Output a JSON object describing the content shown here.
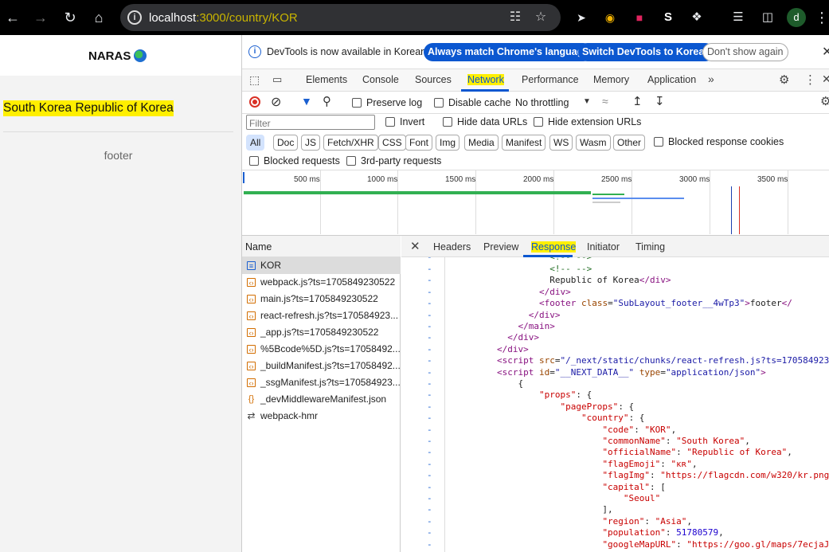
{
  "browser": {
    "url_host": "localhost",
    "url_rest": ":3000/country/KOR",
    "profile_initial": "d"
  },
  "page": {
    "logo": "NARAS",
    "country_title": "South Korea Republic of Korea",
    "footer": "footer"
  },
  "devtools": {
    "infobar": {
      "text": "DevTools is now available in Korean!",
      "btn_match": "Always match Chrome's language",
      "btn_switch": "Switch DevTools to Korean",
      "btn_dont": "Don't show again"
    },
    "tabs": [
      "Elements",
      "Console",
      "Sources",
      "Network",
      "Performance",
      "Memory",
      "Application"
    ],
    "selected_tab": "Network",
    "toolbar": {
      "preserve_log": "Preserve log",
      "disable_cache": "Disable cache",
      "throttling": "No throttling"
    },
    "filter": {
      "placeholder": "Filter",
      "invert": "Invert",
      "hide_data_urls": "Hide data URLs",
      "hide_extension_urls": "Hide extension URLs"
    },
    "type_filters": [
      "All",
      "Doc",
      "JS",
      "Fetch/XHR",
      "CSS",
      "Font",
      "Img",
      "Media",
      "Manifest",
      "WS",
      "Wasm",
      "Other"
    ],
    "blocked_response_cookies": "Blocked response cookies",
    "blocked_requests": "Blocked requests",
    "third_party_requests": "3rd-party requests",
    "timeline_ticks": [
      "500 ms",
      "1000 ms",
      "1500 ms",
      "2000 ms",
      "2500 ms",
      "3000 ms",
      "3500 ms"
    ],
    "name_header": "Name",
    "requests": [
      {
        "name": "KOR",
        "type": "doc"
      },
      {
        "name": "webpack.js?ts=1705849230522",
        "type": "js"
      },
      {
        "name": "main.js?ts=1705849230522",
        "type": "js"
      },
      {
        "name": "react-refresh.js?ts=170584923...",
        "type": "js"
      },
      {
        "name": "_app.js?ts=1705849230522",
        "type": "js"
      },
      {
        "name": "%5Bcode%5D.js?ts=17058492...",
        "type": "js"
      },
      {
        "name": "_buildManifest.js?ts=17058492...",
        "type": "js"
      },
      {
        "name": "_ssgManifest.js?ts=170584923...",
        "type": "js"
      },
      {
        "name": "_devMiddlewareManifest.json",
        "type": "json"
      },
      {
        "name": "webpack-hmr",
        "type": "ws"
      }
    ],
    "detail_tabs": [
      "Headers",
      "Preview",
      "Response",
      "Initiator",
      "Timing"
    ],
    "selected_detail_tab": "Response"
  }
}
